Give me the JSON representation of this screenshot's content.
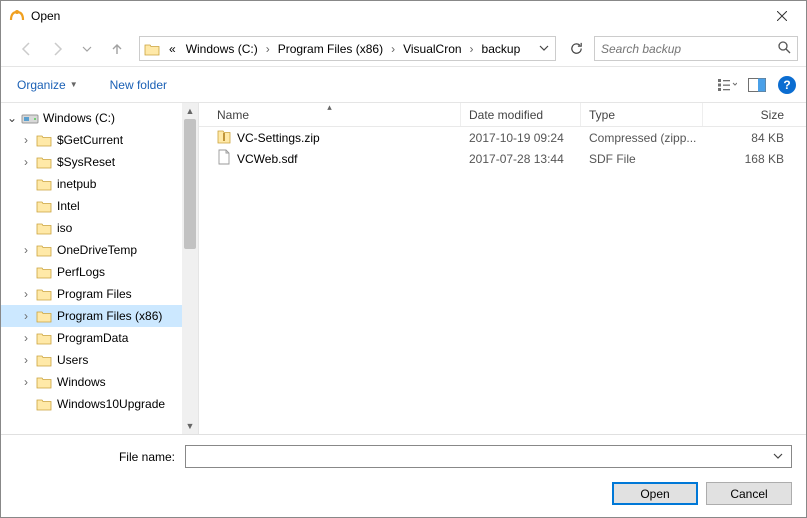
{
  "window": {
    "title": "Open"
  },
  "nav": {
    "breadcrumb_prefix": "«",
    "segments": [
      "Windows (C:)",
      "Program Files (x86)",
      "VisualCron",
      "backup"
    ]
  },
  "search": {
    "placeholder": "Search backup"
  },
  "toolbar": {
    "organize": "Organize",
    "new_folder": "New folder"
  },
  "columns": {
    "name": "Name",
    "date": "Date modified",
    "type": "Type",
    "size": "Size"
  },
  "tree": {
    "root": "Windows (C:)",
    "items": [
      {
        "label": "$GetCurrent",
        "expand": true
      },
      {
        "label": "$SysReset",
        "expand": true
      },
      {
        "label": "inetpub",
        "expand": false
      },
      {
        "label": "Intel",
        "expand": false
      },
      {
        "label": "iso",
        "expand": false
      },
      {
        "label": "OneDriveTemp",
        "expand": true
      },
      {
        "label": "PerfLogs",
        "expand": false
      },
      {
        "label": "Program Files",
        "expand": true
      },
      {
        "label": "Program Files (x86)",
        "expand": true,
        "selected": true
      },
      {
        "label": "ProgramData",
        "expand": true
      },
      {
        "label": "Users",
        "expand": true
      },
      {
        "label": "Windows",
        "expand": true
      },
      {
        "label": "Windows10Upgrade",
        "expand": false
      }
    ]
  },
  "files": [
    {
      "name": "VC-Settings.zip",
      "date": "2017-10-19 09:24",
      "type": "Compressed (zipp...",
      "size": "84 KB",
      "icon": "zip"
    },
    {
      "name": "VCWeb.sdf",
      "date": "2017-07-28 13:44",
      "type": "SDF File",
      "size": "168 KB",
      "icon": "file"
    }
  ],
  "footer": {
    "filename_label": "File name:",
    "filename_value": "",
    "open": "Open",
    "cancel": "Cancel"
  }
}
